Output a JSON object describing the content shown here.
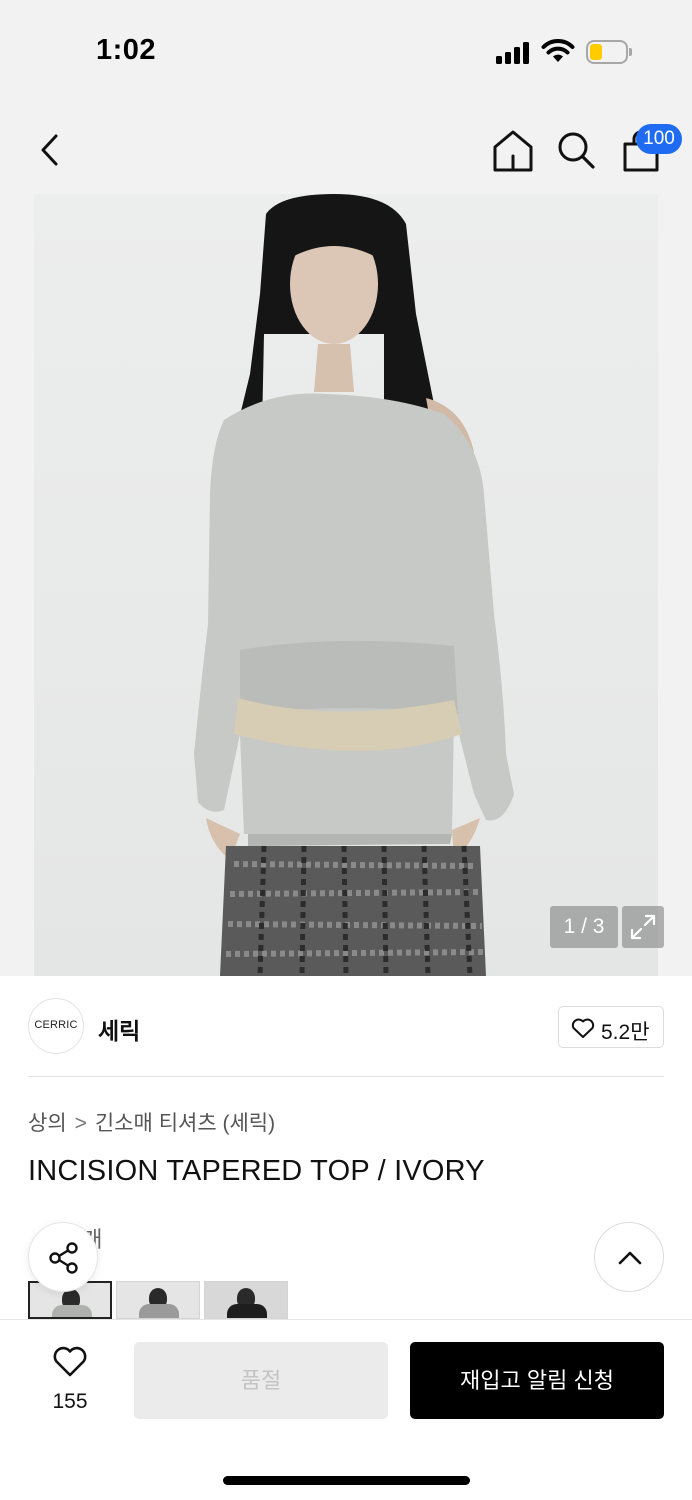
{
  "status_bar": {
    "time": "1:02"
  },
  "header": {
    "cart_count": "100"
  },
  "gallery": {
    "counter": "1 / 3"
  },
  "brand": {
    "logo_text": "CERRIC",
    "name": "세릭",
    "likes": "5.2만"
  },
  "product": {
    "breadcrumb": {
      "category": "상의",
      "separator": ">",
      "subcategory": "긴소매 티셔츠 (세릭)"
    },
    "title": "INCISION TAPERED TOP / IVORY",
    "color_count_label": "3개"
  },
  "bottom_bar": {
    "like_count": "155",
    "soldout_label": "품절",
    "restock_label": "재입고 알림 신청"
  },
  "colors": {
    "accent": "#1f6cf2",
    "battery": "#ffcc00",
    "primary_button": "#000000",
    "disabled_button": "#ebebeb"
  },
  "icons": [
    "back-arrow-icon",
    "home-icon",
    "search-icon",
    "shopping-bag-icon",
    "expand-icon",
    "heart-icon",
    "share-icon",
    "chevron-up-icon"
  ]
}
